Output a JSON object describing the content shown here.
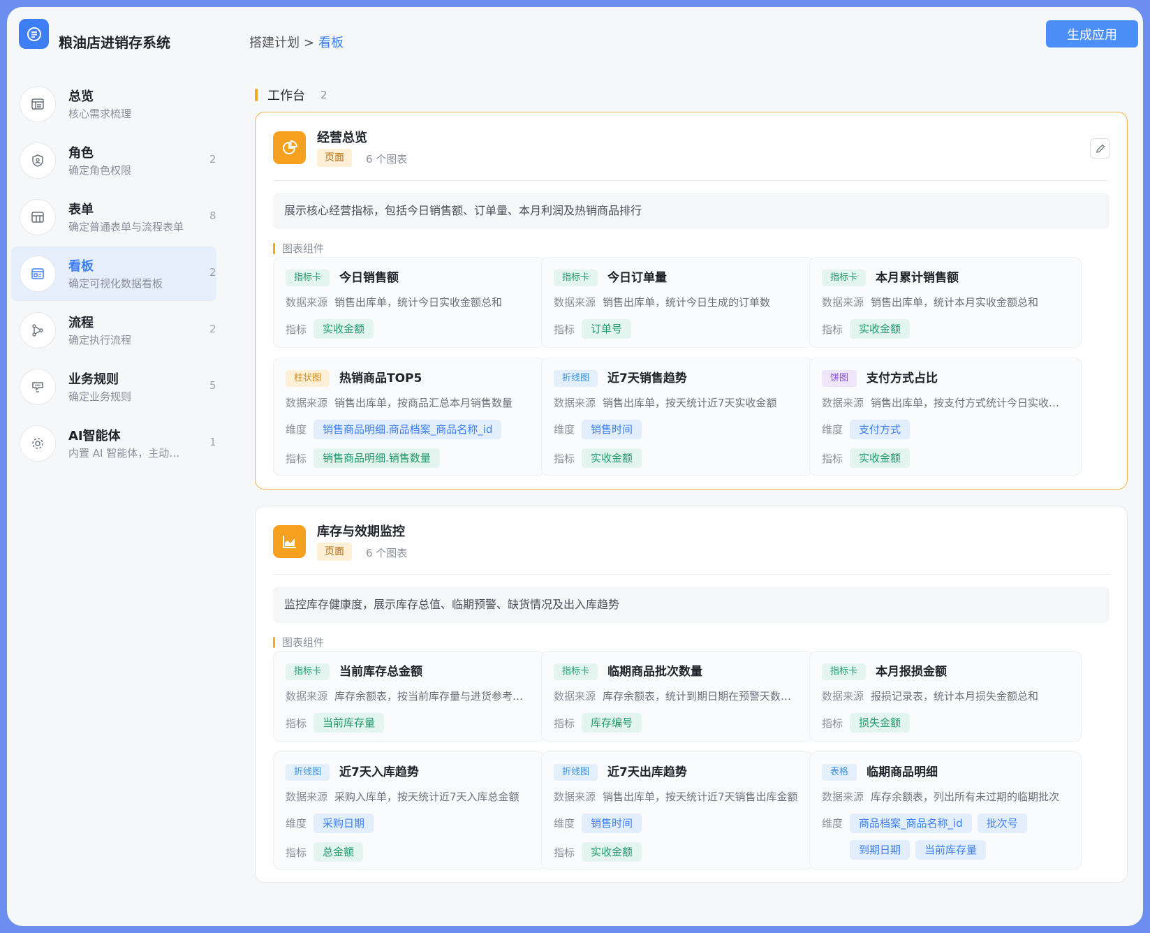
{
  "app": {
    "title": "粮油店进销存系统"
  },
  "breadcrumb": {
    "parent": "搭建计划",
    "separator": ">",
    "current": "看板"
  },
  "header": {
    "generate_label": "生成应用"
  },
  "sidebar": {
    "items": [
      {
        "title": "总览",
        "sub": "核心需求梳理",
        "count": "",
        "icon": "overview-icon"
      },
      {
        "title": "角色",
        "sub": "确定角色权限",
        "count": "2",
        "icon": "shield-user-icon"
      },
      {
        "title": "表单",
        "sub": "确定普通表单与流程表单",
        "count": "8",
        "icon": "table-icon"
      },
      {
        "title": "看板",
        "sub": "确定可视化数据看板",
        "count": "2",
        "icon": "dashboard-icon"
      },
      {
        "title": "流程",
        "sub": "确定执行流程",
        "count": "2",
        "icon": "flow-icon"
      },
      {
        "title": "业务规则",
        "sub": "确定业务规则",
        "count": "5",
        "icon": "rule-icon"
      },
      {
        "title": "AI智能体",
        "sub": "内置 AI 智能体，主动协助",
        "count": "1",
        "icon": "gear-icon"
      }
    ]
  },
  "workspace": {
    "title": "工作台",
    "count": "2"
  },
  "labels": {
    "page_tag": "页面",
    "components": "图表组件",
    "source": "数据来源",
    "dimension": "维度",
    "metric": "指标"
  },
  "dashboards": [
    {
      "title": "经营总览",
      "chart_count": "6 个图表",
      "icon": "pie-chart-icon",
      "desc": "展示核心经营指标，包括今日销售额、订单量、本月利润及热销商品排行",
      "widgets": [
        {
          "tag": "指标卡",
          "title": "今日销售额",
          "source": "销售出库单，统计今日实收金额总和",
          "dims": [],
          "metrics": [
            "实收金额"
          ]
        },
        {
          "tag": "指标卡",
          "title": "今日订单量",
          "source": "销售出库单，统计今日生成的订单数",
          "dims": [],
          "metrics": [
            "订单号"
          ]
        },
        {
          "tag": "指标卡",
          "title": "本月累计销售额",
          "source": "销售出库单，统计本月实收金额总和",
          "dims": [],
          "metrics": [
            "实收金额"
          ]
        },
        {
          "tag": "柱状图",
          "title": "热销商品TOP5",
          "source": "销售出库单，按商品汇总本月销售数量",
          "dims": [
            "销售商品明细.商品档案_商品名称_id"
          ],
          "metrics": [
            "销售商品明细.销售数量"
          ]
        },
        {
          "tag": "折线图",
          "title": "近7天销售趋势",
          "source": "销售出库单，按天统计近7天实收金额",
          "dims": [
            "销售时间"
          ],
          "metrics": [
            "实收金额"
          ]
        },
        {
          "tag": "饼图",
          "title": "支付方式占比",
          "source": "销售出库单，按支付方式统计今日实收金额",
          "dims": [
            "支付方式"
          ],
          "metrics": [
            "实收金额"
          ]
        }
      ]
    },
    {
      "title": "库存与效期监控",
      "chart_count": "6 个图表",
      "icon": "area-chart-icon",
      "desc": "监控库存健康度，展示库存总值、临期预警、缺货情况及出入库趋势",
      "widgets": [
        {
          "tag": "指标卡",
          "title": "当前库存总金额",
          "source": "库存余额表，按当前库存量与进货参考价计算",
          "dims": [],
          "metrics": [
            "当前库存量"
          ]
        },
        {
          "tag": "指标卡",
          "title": "临期商品批次数量",
          "source": "库存余额表，统计到期日期在预警天数内的批次",
          "dims": [],
          "metrics": [
            "库存编号"
          ]
        },
        {
          "tag": "指标卡",
          "title": "本月报损金额",
          "source": "报损记录表，统计本月损失金额总和",
          "dims": [],
          "metrics": [
            "损失金额"
          ]
        },
        {
          "tag": "折线图",
          "title": "近7天入库趋势",
          "source": "采购入库单，按天统计近7天入库总金额",
          "dims": [
            "采购日期"
          ],
          "metrics": [
            "总金额"
          ]
        },
        {
          "tag": "折线图",
          "title": "近7天出库趋势",
          "source": "销售出库单，按天统计近7天销售出库金额",
          "dims": [
            "销售时间"
          ],
          "metrics": [
            "实收金额"
          ]
        },
        {
          "tag": "表格",
          "title": "临期商品明细",
          "source": "库存余额表，列出所有未过期的临期批次",
          "dims": [
            "商品档案_商品名称_id",
            "批次号",
            "到期日期",
            "当前库存量"
          ],
          "metrics": []
        }
      ]
    }
  ]
}
